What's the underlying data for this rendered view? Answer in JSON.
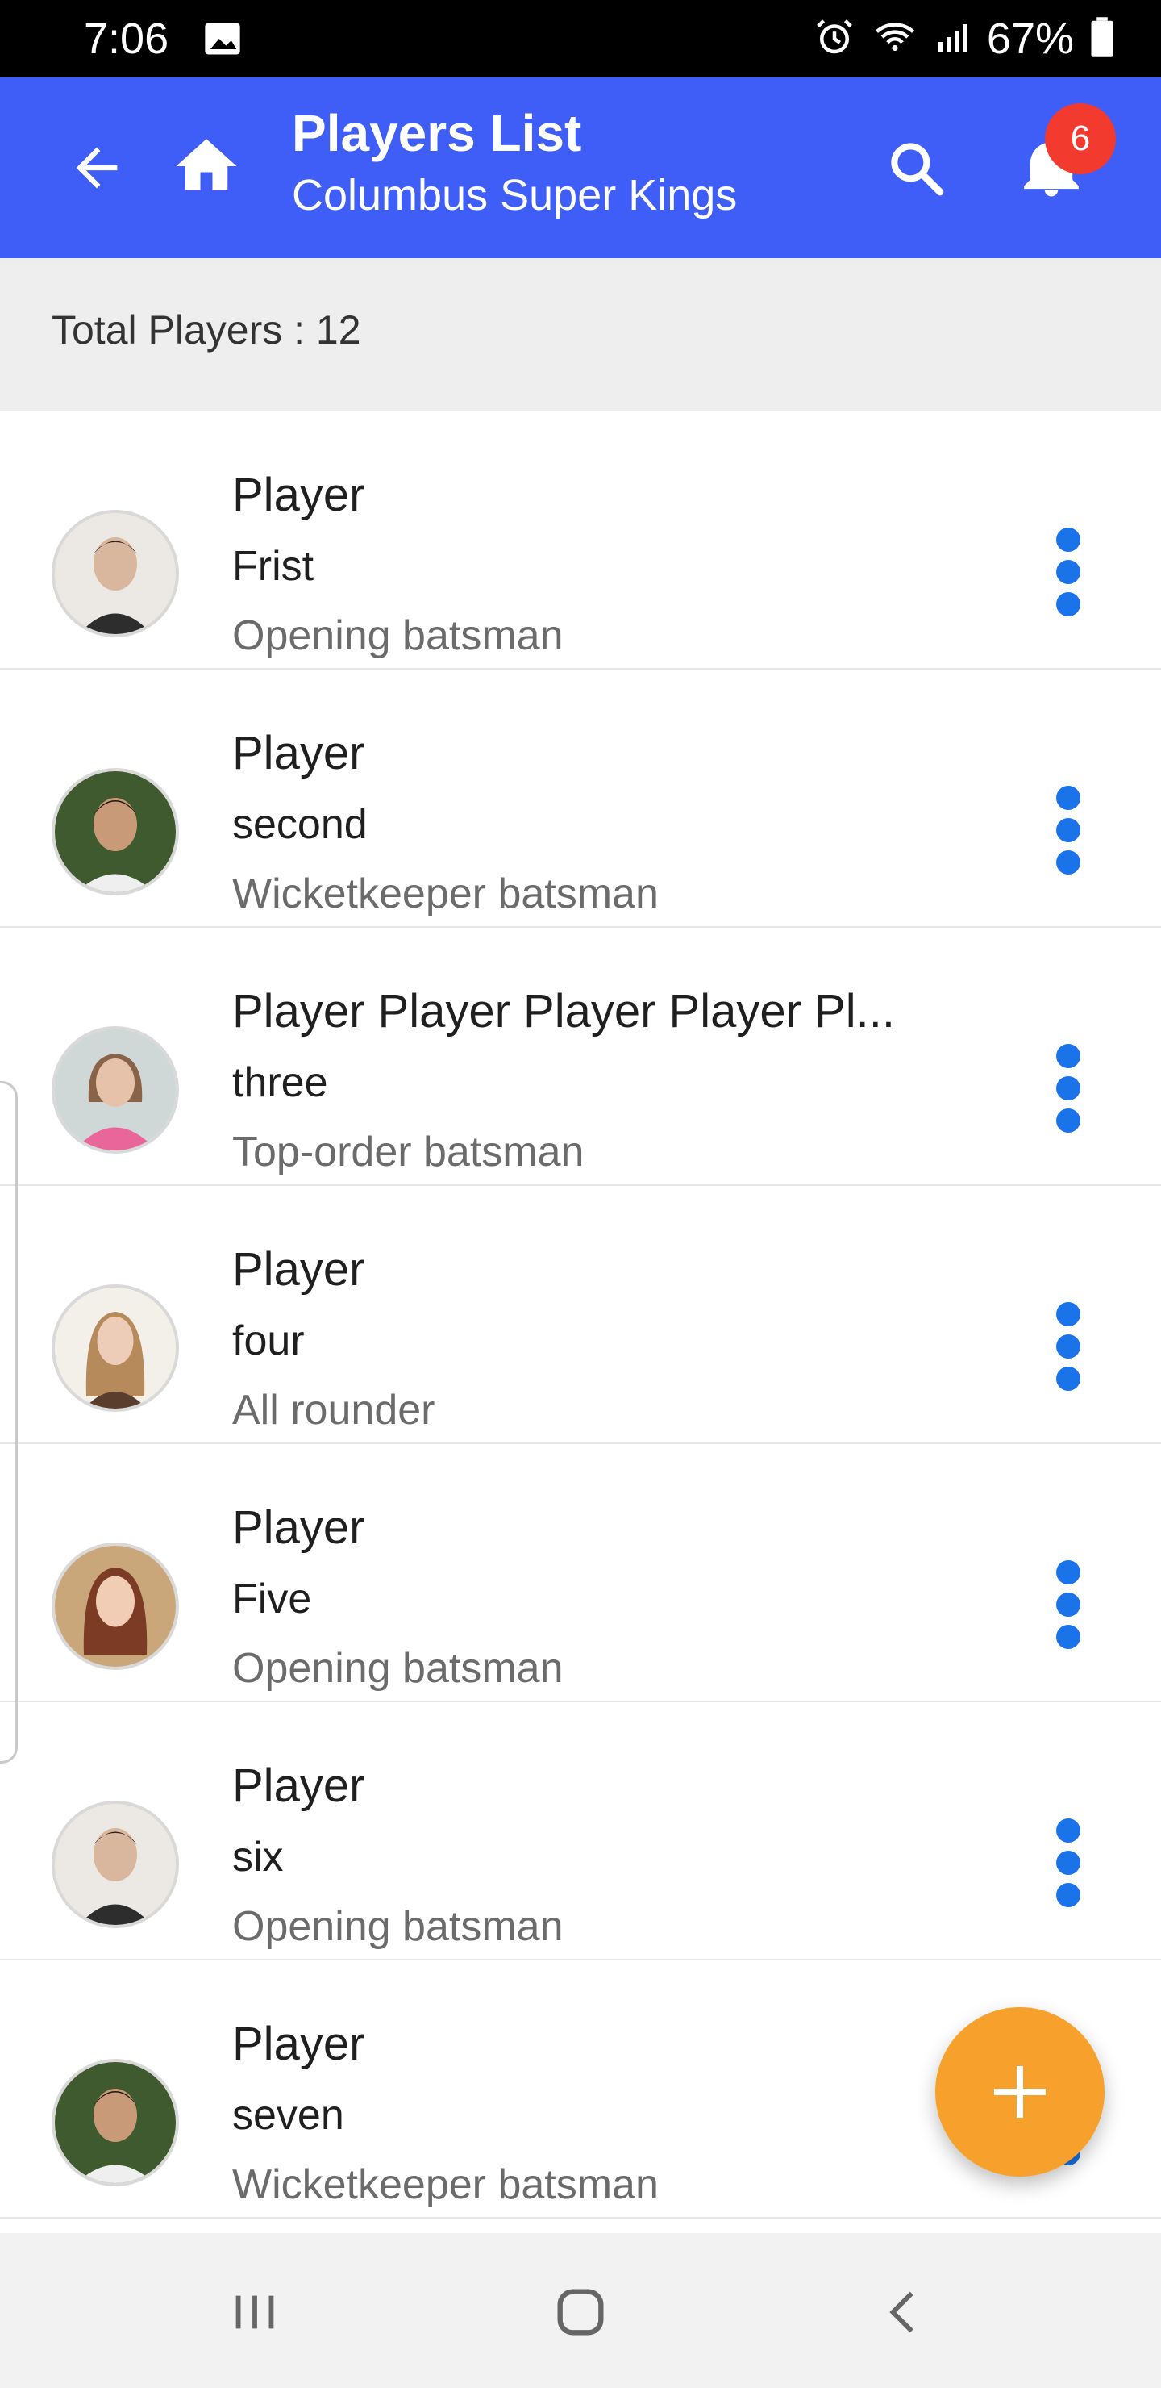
{
  "status_bar": {
    "time": "7:06",
    "battery": "67%"
  },
  "app_bar": {
    "title": "Players List",
    "subtitle": "Columbus Super Kings",
    "notification_count": "6"
  },
  "summary": {
    "total_players": "Total Players : 12"
  },
  "players": [
    {
      "name": "Player",
      "second": "Frist",
      "role": "Opening batsman"
    },
    {
      "name": "Player",
      "second": "second",
      "role": "Wicketkeeper batsman"
    },
    {
      "name": "Player Player Player Player Pl...",
      "second": "three",
      "role": "Top-order batsman"
    },
    {
      "name": "Player",
      "second": "four",
      "role": "All rounder"
    },
    {
      "name": "Player",
      "second": "Five",
      "role": "Opening batsman"
    },
    {
      "name": "Player",
      "second": "six",
      "role": "Opening batsman"
    },
    {
      "name": "Player",
      "second": "seven",
      "role": "Wicketkeeper batsman"
    }
  ],
  "colors": {
    "app_bar": "#3f5ef8",
    "fab": "#f7a12c",
    "accent_blue": "#1a73e8",
    "badge": "#f23a2f"
  },
  "icons": [
    "back-arrow-icon",
    "home-icon",
    "search-icon",
    "bell-icon",
    "more-vert-icon",
    "plus-icon",
    "recents-icon",
    "home-circle-icon",
    "back-chevron-icon"
  ]
}
